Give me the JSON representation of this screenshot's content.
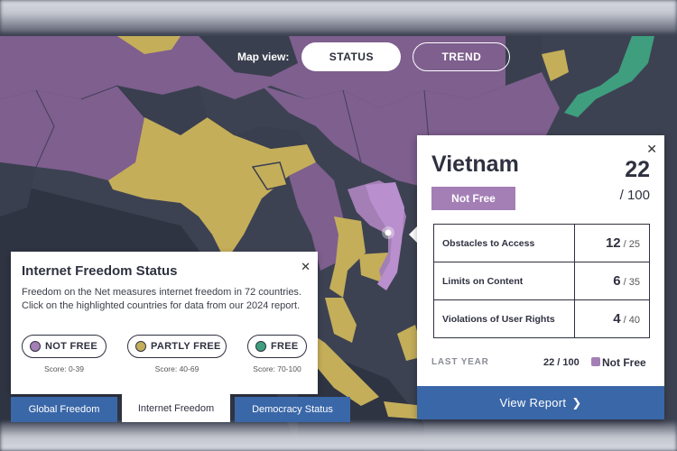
{
  "colors": {
    "not_free": "#a47fb6",
    "partly_free": "#c4ae5a",
    "free": "#3e9e7e",
    "map_base": "#363b4b",
    "accent_blue": "#3a67a8"
  },
  "map_view": {
    "label": "Map view:",
    "options": [
      "STATUS",
      "TREND"
    ],
    "selected": "STATUS"
  },
  "country_popup": {
    "name": "Vietnam",
    "score": "22",
    "score_max": "/ 100",
    "status": "Not Free",
    "close_icon": "close-icon",
    "categories": [
      {
        "label": "Obstacles to Access",
        "value": "12",
        "max": "/ 25"
      },
      {
        "label": "Limits on Content",
        "value": "6",
        "max": "/ 35"
      },
      {
        "label": "Violations of User Rights",
        "value": "4",
        "max": "/ 40"
      }
    ],
    "last_year_label": "LAST YEAR",
    "last_year_score": "22 / 100",
    "last_year_status": "Not Free",
    "view_report": "View Report"
  },
  "legend": {
    "title": "Internet Freedom Status",
    "description": "Freedom on the Net measures internet freedom in 72 countries. Click on the highlighted countries for data from our 2024 report.",
    "items": [
      {
        "label": "NOT FREE",
        "score": "Score: 0-39"
      },
      {
        "label": "PARTLY FREE",
        "score": "Score: 40-69"
      },
      {
        "label": "FREE",
        "score": "Score: 70-100"
      }
    ]
  },
  "tabs": [
    {
      "label": "Global Freedom"
    },
    {
      "label": "Internet Freedom"
    },
    {
      "label": "Democracy Status"
    }
  ]
}
